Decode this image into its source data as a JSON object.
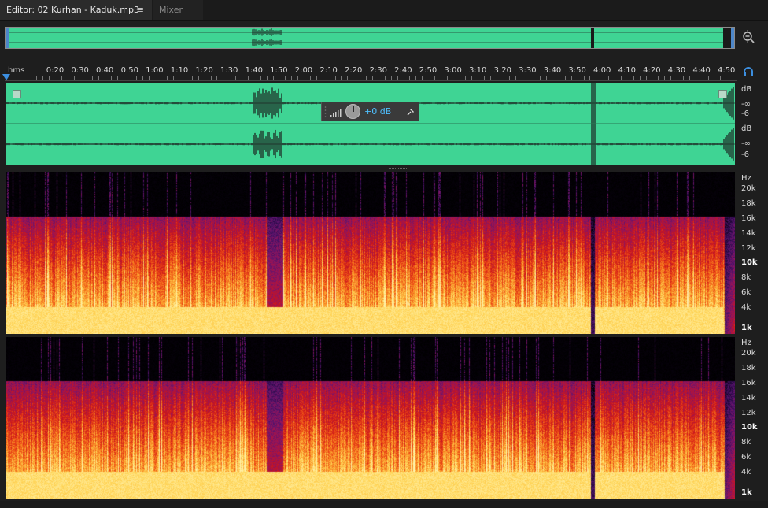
{
  "tabs": [
    {
      "label": "Editor: 02 Kurhan - Kaduk.mp3",
      "menu": "≡"
    },
    {
      "label": "Mixer"
    }
  ],
  "ruler": {
    "unit": "hms",
    "labels": [
      "0:20",
      "0:30",
      "0:40",
      "0:50",
      "1:00",
      "1:10",
      "1:20",
      "1:30",
      "1:40",
      "1:50",
      "2:00",
      "2:10",
      "2:20",
      "2:30",
      "2:40",
      "2:50",
      "3:00",
      "3:10",
      "3:20",
      "3:30",
      "3:40",
      "3:50",
      "4:00",
      "4:10",
      "4:20",
      "4:30",
      "4:40",
      "4:50"
    ]
  },
  "hud": {
    "volume_label": "+0 dB"
  },
  "db_scale": {
    "top": [
      "dB",
      "-∞",
      "-6"
    ],
    "bottom": [
      "dB",
      "-∞",
      "-6"
    ]
  },
  "hz_scale": {
    "labels": [
      "Hz",
      "20k",
      "18k",
      "16k",
      "14k",
      "12k",
      "10k",
      "8k",
      "6k",
      "4k",
      "1k"
    ]
  },
  "colors": {
    "waveform": "#3fd494",
    "accent": "#3c8fe0",
    "volume_value": "#4ec0ff"
  },
  "icons": {
    "zoom": "zoom-out-icon",
    "monitor": "headphones-icon",
    "pin": "pin-icon"
  }
}
